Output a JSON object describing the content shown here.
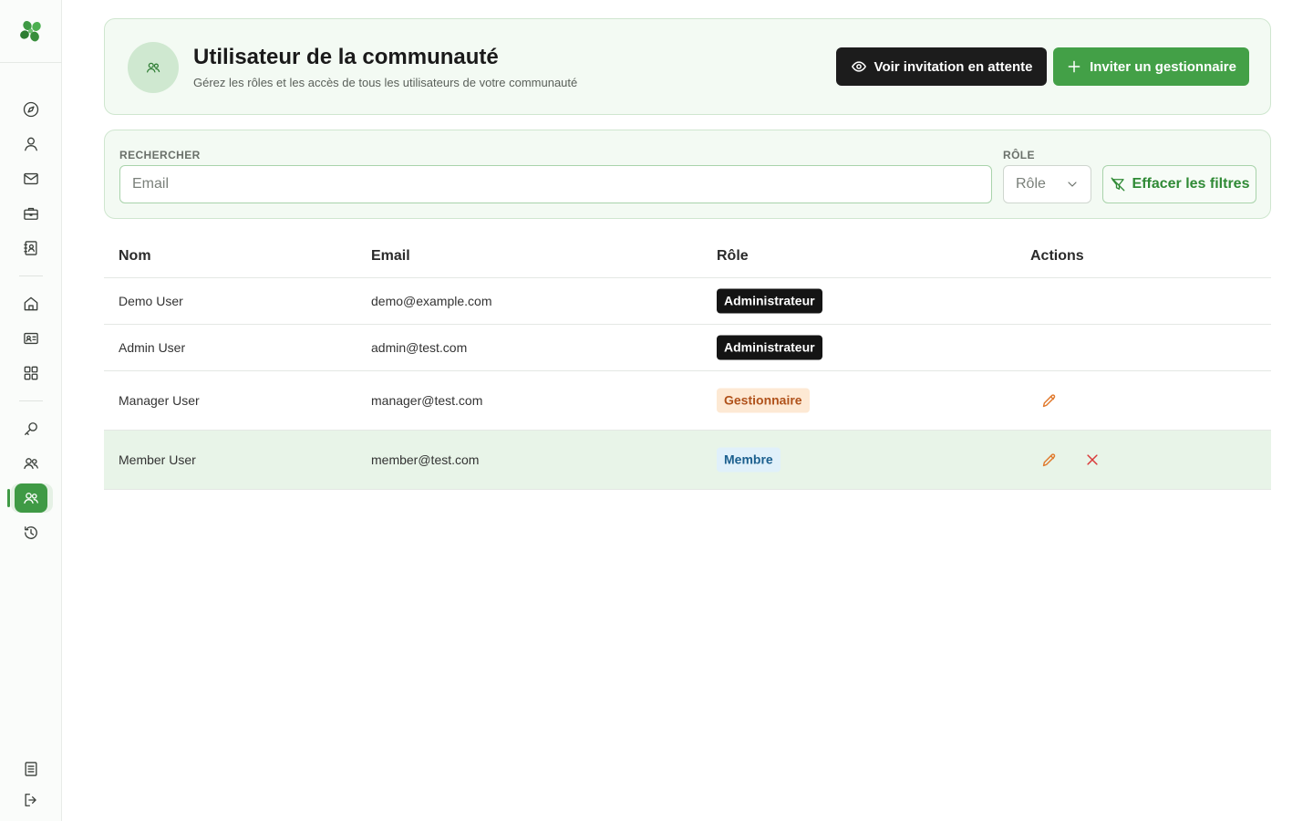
{
  "header": {
    "title": "Utilisateur de la communauté",
    "subtitle": "Gérez les rôles et les accès de tous les utilisateurs de votre communauté",
    "view_pending_label": "Voir invitation en attente",
    "invite_label": "Inviter un gestionnaire"
  },
  "filters": {
    "search_label": "RECHERCHER",
    "search_placeholder": "Email",
    "search_value": "",
    "role_label": "RÔLE",
    "role_value": "Rôle",
    "clear_label": "Effacer les filtres"
  },
  "table": {
    "columns": [
      "Nom",
      "Email",
      "Rôle",
      "Actions"
    ],
    "rows": [
      {
        "name": "Demo User",
        "email": "demo@example.com",
        "role": "Administrateur",
        "role_kind": "admin",
        "actions": []
      },
      {
        "name": "Admin User",
        "email": "admin@test.com",
        "role": "Administrateur",
        "role_kind": "admin",
        "actions": []
      },
      {
        "name": "Manager User",
        "email": "manager@test.com",
        "role": "Gestionnaire",
        "role_kind": "manager",
        "actions": [
          "edit-icon"
        ]
      },
      {
        "name": "Member User",
        "email": "member@test.com",
        "role": "Membre",
        "role_kind": "member",
        "actions": [
          "edit-icon",
          "close-icon"
        ]
      }
    ]
  },
  "sidebar": {
    "items": [
      {
        "icon": "compass-icon"
      },
      {
        "icon": "user-icon"
      },
      {
        "icon": "mail-icon"
      },
      {
        "icon": "briefcase-icon"
      },
      {
        "icon": "contact-book-icon"
      },
      {
        "icon": "home-icon"
      },
      {
        "icon": "id-card-icon"
      },
      {
        "icon": "grid-icon"
      },
      {
        "icon": "key-icon"
      },
      {
        "icon": "users-icon"
      },
      {
        "icon": "community-users-icon",
        "active": true
      },
      {
        "icon": "history-icon"
      },
      {
        "icon": "document-icon"
      },
      {
        "icon": "logout-icon"
      }
    ]
  },
  "colors": {
    "accent": "#43a047",
    "dark": "#1c1c1c",
    "card_bg": "#f3faf3",
    "card_border": "#cfe6cf",
    "edit": "#e07a2e",
    "delete": "#d93a3a"
  }
}
